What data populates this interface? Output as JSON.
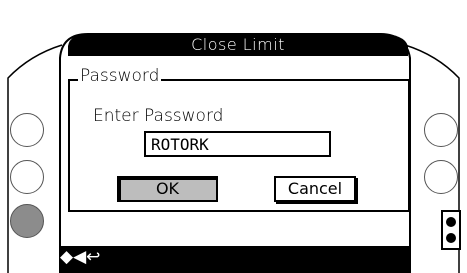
{
  "header": {
    "title": "Close Limit"
  },
  "dialog": {
    "group_label": "Password",
    "prompt": "Enter Password",
    "password_value": "ROTORK",
    "ok_label": "OK",
    "cancel_label": "Cancel"
  },
  "footer": {
    "hint": "◆◀↩"
  },
  "side_buttons": {
    "left": [
      "left-button-1",
      "left-button-2",
      "left-button-3"
    ],
    "right": [
      "right-button-1",
      "right-button-2"
    ],
    "active": "left-button-3"
  },
  "colors": {
    "bar": "#000000",
    "ok_button": "#bdbdbd",
    "active_side_button": "#8c8c8c"
  }
}
